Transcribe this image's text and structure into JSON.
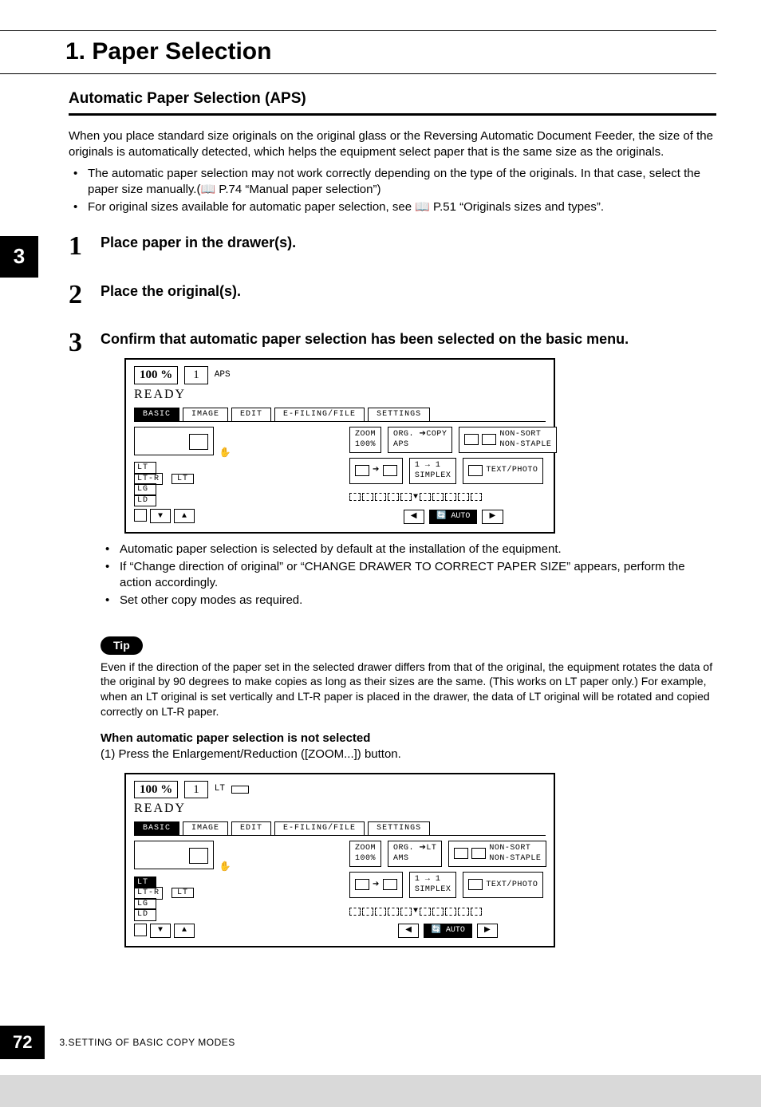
{
  "title": "1. Paper Selection",
  "section_heading": "Automatic Paper Selection (APS)",
  "intro": "When you place standard size originals on the original glass or the Reversing Automatic Document Feeder, the size of the originals is automatically detected, which helps the equipment select paper that is the same size as the originals.",
  "intro_bullets": [
    "The automatic paper selection may not work correctly depending on the type of the originals. In that case, select the paper size manually.(📖 P.74 “Manual paper selection”)",
    "For original sizes available for automatic paper selection, see 📖 P.51 “Originals sizes and types”."
  ],
  "chapter_tab": "3",
  "steps": [
    {
      "num": "1",
      "title": "Place paper in the drawer(s)."
    },
    {
      "num": "2",
      "title": "Place the original(s)."
    },
    {
      "num": "3",
      "title": "Confirm that automatic paper selection has been selected on the basic menu."
    }
  ],
  "panel_common": {
    "percent": "100 %",
    "quantity": "1",
    "ready": "READY",
    "tabs": [
      "BASIC",
      "IMAGE",
      "EDIT",
      "E-FILING/FILE",
      "SETTINGS"
    ],
    "drawers": [
      "LT",
      "LT-R",
      "LG",
      "LD"
    ],
    "big_label": "LT",
    "zoom": "ZOOM\n100%",
    "simplex": "1 → 1\nSIMPLEX",
    "nonsort": "NON-SORT\nNON-STAPLE",
    "textphoto": "TEXT/PHOTO",
    "auto": "AUTO"
  },
  "panel1_mode": "APS",
  "panel1_orgcopy": "ORG. ➔COPY\nAPS",
  "panel2_mode": "LT",
  "panel2_orgcopy": "ORG. ➔LT\nAMS",
  "step3_bullets": [
    "Automatic paper selection is selected by default at the installation of the equipment.",
    "If “Change direction of original” or “CHANGE DRAWER TO CORRECT PAPER SIZE” appears, perform the action accordingly.",
    "Set other copy modes as required."
  ],
  "tip_label": "Tip",
  "tip_text": "Even if the direction of the paper set in the selected drawer differs from that of the original, the equipment rotates the data of the original by 90 degrees to make copies as long as their sizes are the same. (This works on LT paper only.) For example, when an LT original is set vertically and LT-R paper is placed in the drawer, the data of LT original will be rotated and copied correctly on LT-R paper.",
  "subhead": "When automatic paper selection is not selected",
  "subline": "(1) Press the Enlargement/Reduction ([ZOOM...]) button.",
  "page_number": "72",
  "footer_text": "3.SETTING OF BASIC COPY MODES"
}
